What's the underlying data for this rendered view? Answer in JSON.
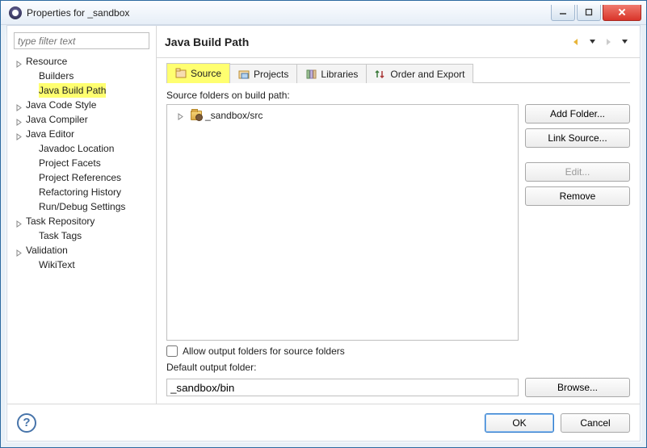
{
  "title": "Properties for _sandbox",
  "filter_placeholder": "type filter text",
  "tree_items": [
    {
      "label": "Resource",
      "expandable": true,
      "indent": false
    },
    {
      "label": "Builders",
      "expandable": false,
      "indent": true
    },
    {
      "label": "Java Build Path",
      "expandable": false,
      "indent": true,
      "selected": true
    },
    {
      "label": "Java Code Style",
      "expandable": true,
      "indent": false
    },
    {
      "label": "Java Compiler",
      "expandable": true,
      "indent": false
    },
    {
      "label": "Java Editor",
      "expandable": true,
      "indent": false
    },
    {
      "label": "Javadoc Location",
      "expandable": false,
      "indent": true
    },
    {
      "label": "Project Facets",
      "expandable": false,
      "indent": true
    },
    {
      "label": "Project References",
      "expandable": false,
      "indent": true
    },
    {
      "label": "Refactoring History",
      "expandable": false,
      "indent": true
    },
    {
      "label": "Run/Debug Settings",
      "expandable": false,
      "indent": true
    },
    {
      "label": "Task Repository",
      "expandable": true,
      "indent": false
    },
    {
      "label": "Task Tags",
      "expandable": false,
      "indent": true
    },
    {
      "label": "Validation",
      "expandable": true,
      "indent": false
    },
    {
      "label": "WikiText",
      "expandable": false,
      "indent": true
    }
  ],
  "page_title": "Java Build Path",
  "tabs": [
    {
      "label": "Source",
      "active": true,
      "highlight": true,
      "icon": "source"
    },
    {
      "label": "Projects",
      "icon": "projects"
    },
    {
      "label": "Libraries",
      "icon": "libraries"
    },
    {
      "label": "Order and Export",
      "icon": "order"
    }
  ],
  "source_tab": {
    "label": "Source folders on build path:",
    "entries": [
      {
        "label": "_sandbox/src"
      }
    ],
    "buttons": {
      "add_folder": "Add Folder...",
      "link_source": "Link Source...",
      "edit": "Edit...",
      "remove": "Remove"
    },
    "allow_output_label": "Allow output folders for source folders",
    "allow_output_checked": false,
    "default_output_label": "Default output folder:",
    "default_output_value": "_sandbox/bin",
    "browse": "Browse..."
  },
  "footer": {
    "ok": "OK",
    "cancel": "Cancel"
  }
}
